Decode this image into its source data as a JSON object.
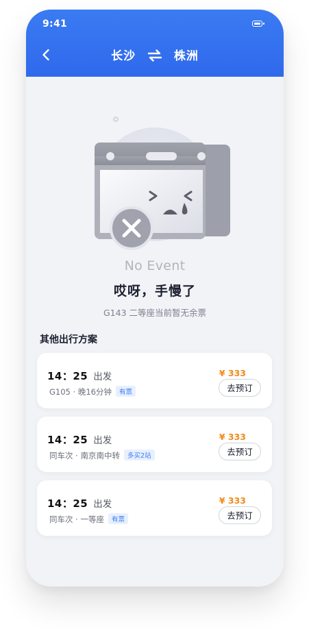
{
  "status_bar": {
    "time": "9:41",
    "icons": [
      "battery-icon"
    ]
  },
  "header": {
    "from": "长沙",
    "to": "株洲",
    "back_icon": "chevron-left-icon",
    "swap_icon": "swap-arrows-icon"
  },
  "empty_state": {
    "illustration_icon": "sad-calendar-with-x-icon",
    "caption": "No Event",
    "title": "哎呀，手慢了",
    "subtitle": "G143 二等座当前暂无余票"
  },
  "section_title": "其他出行方案",
  "options": [
    {
      "time": "14：25",
      "depart_label": "出发",
      "detail": "G105 · 晚16分钟",
      "tag": "有票",
      "price": "¥ 333",
      "book_label": "去预订"
    },
    {
      "time": "14：25",
      "depart_label": "出发",
      "detail": "同车次 · 南京南中转",
      "tag": "多买2站",
      "price": "¥ 333",
      "book_label": "去预订"
    },
    {
      "time": "14：25",
      "depart_label": "出发",
      "detail": "同车次 · 一等座",
      "tag": "有票",
      "price": "¥ 333",
      "book_label": "去预订"
    }
  ],
  "colors": {
    "header_blue": "#2f69ec",
    "price_orange": "#f08a1c",
    "tag_blue": "#3a7bf2",
    "background": "#f2f3f7"
  }
}
